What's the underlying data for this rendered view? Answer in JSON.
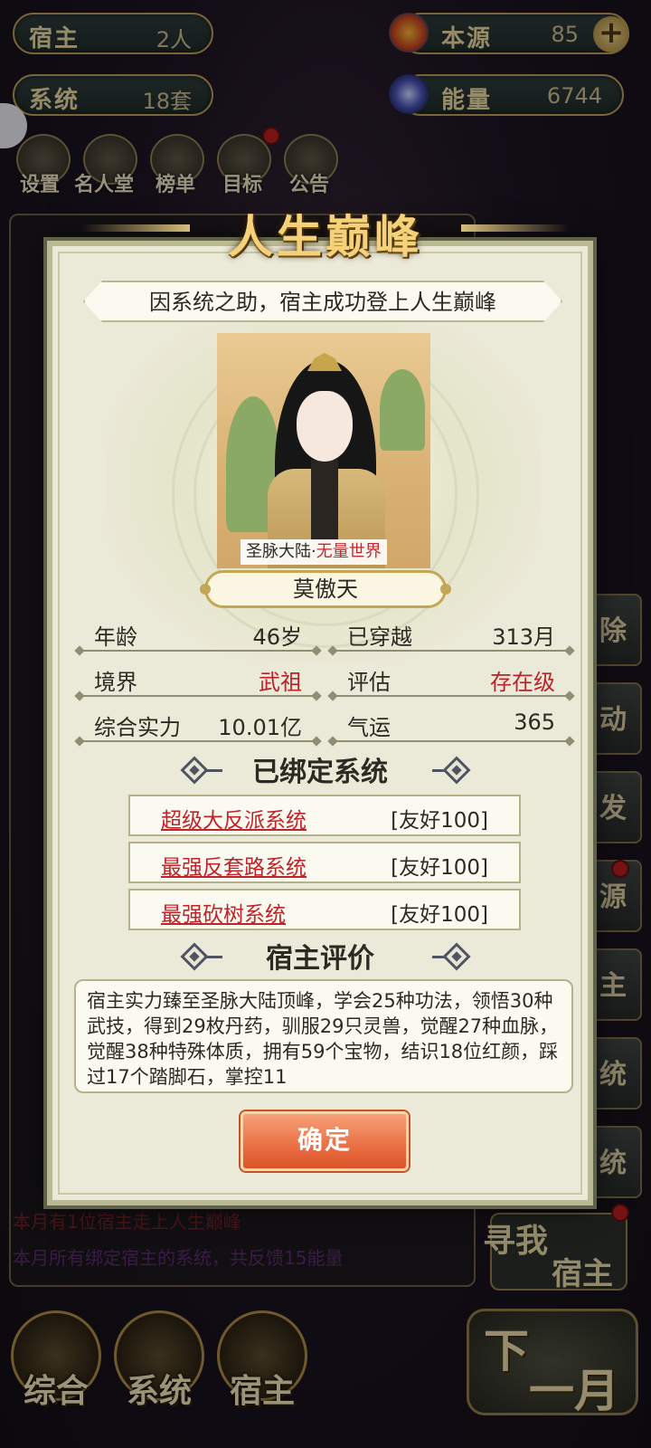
{
  "top_bar": {
    "host": {
      "label": "宿主",
      "value": "2人"
    },
    "source": {
      "label": "本源",
      "value": "85"
    },
    "system": {
      "label": "系统",
      "value": "18套"
    },
    "energy": {
      "label": "能量",
      "value": "6744"
    }
  },
  "menu": [
    {
      "label": "设置",
      "icon": "gear-icon"
    },
    {
      "label": "名人堂",
      "icon": "hall-of-fame-icon"
    },
    {
      "label": "榜单",
      "icon": "ranking-icon"
    },
    {
      "label": "目标",
      "icon": "target-icon"
    },
    {
      "label": "公告",
      "icon": "announcement-icon"
    }
  ],
  "side_buttons": [
    "除",
    "动",
    "发",
    "源",
    "主",
    "统",
    "统"
  ],
  "background_log": {
    "line1": "本月有1位宿主走上人生巅峰",
    "line2": "本月所有绑定宿主的系统，共反馈15能量"
  },
  "modal": {
    "title": "人生巅峰",
    "subtitle": "因系统之助，宿主成功登上人生巅峰",
    "world": {
      "prefix": "圣脉大陆·",
      "highlight": "无量世界"
    },
    "name": "莫傲天",
    "stats": {
      "age_label": "年龄",
      "age_value": "46岁",
      "travel_label": "已穿越",
      "travel_value": "313月",
      "realm_label": "境界",
      "realm_value": "武祖",
      "rating_label": "评估",
      "rating_value": "存在级",
      "power_label": "综合实力",
      "power_value": "10.01亿",
      "luck_label": "气运",
      "luck_value": "365"
    },
    "bound_title": "已绑定系统",
    "systems": [
      {
        "name": "超级大反派系统",
        "favor": "[友好100]"
      },
      {
        "name": "最强反套路系统",
        "favor": "[友好100]"
      },
      {
        "name": "最强砍树系统",
        "favor": "[友好100]"
      }
    ],
    "eval_title": "宿主评价",
    "evaluation": "宿主实力臻至圣脉大陆顶峰，学会25种功法，领悟30种武技，得到29枚丹药，驯服29只灵兽，觉醒27种血脉，觉醒38种特殊体质，拥有59个宝物，结识18位红颜，踩过17个踏脚石，掌控11",
    "confirm": "确定"
  },
  "find_host": {
    "line1": "寻我",
    "line2": "宿主"
  },
  "bottom_nav": {
    "overall": "综合",
    "system": "系统",
    "host": "宿主",
    "next_1": "下",
    "next_2": "一月"
  },
  "colors": {
    "accent_red": "#c0232a",
    "confirm_orange": "#e8673c",
    "gold": "#c3a756"
  }
}
